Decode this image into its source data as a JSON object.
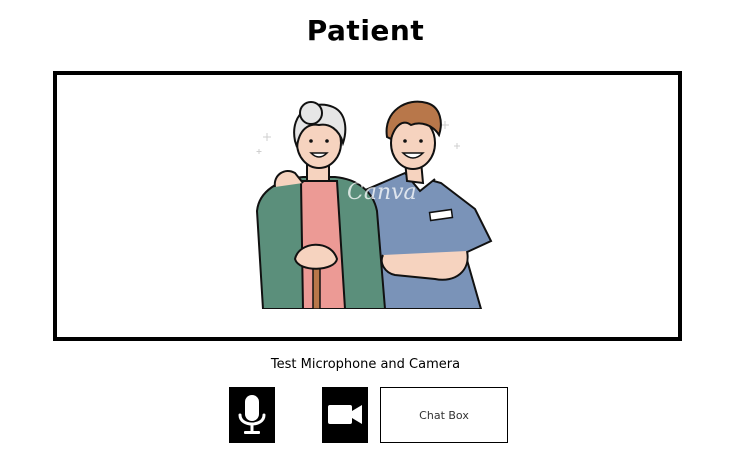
{
  "page": {
    "title": "Patient"
  },
  "video": {
    "image_description": "illustration-elderly-woman-and-nurse",
    "watermark": "Canva"
  },
  "controls": {
    "test_label": "Test Microphone and Camera",
    "mic_icon": "microphone-icon",
    "camera_icon": "video-camera-icon",
    "chat_label": "Chat Box"
  },
  "colors": {
    "frame_border": "#000000",
    "button_bg": "#000000",
    "icon": "#ffffff"
  }
}
